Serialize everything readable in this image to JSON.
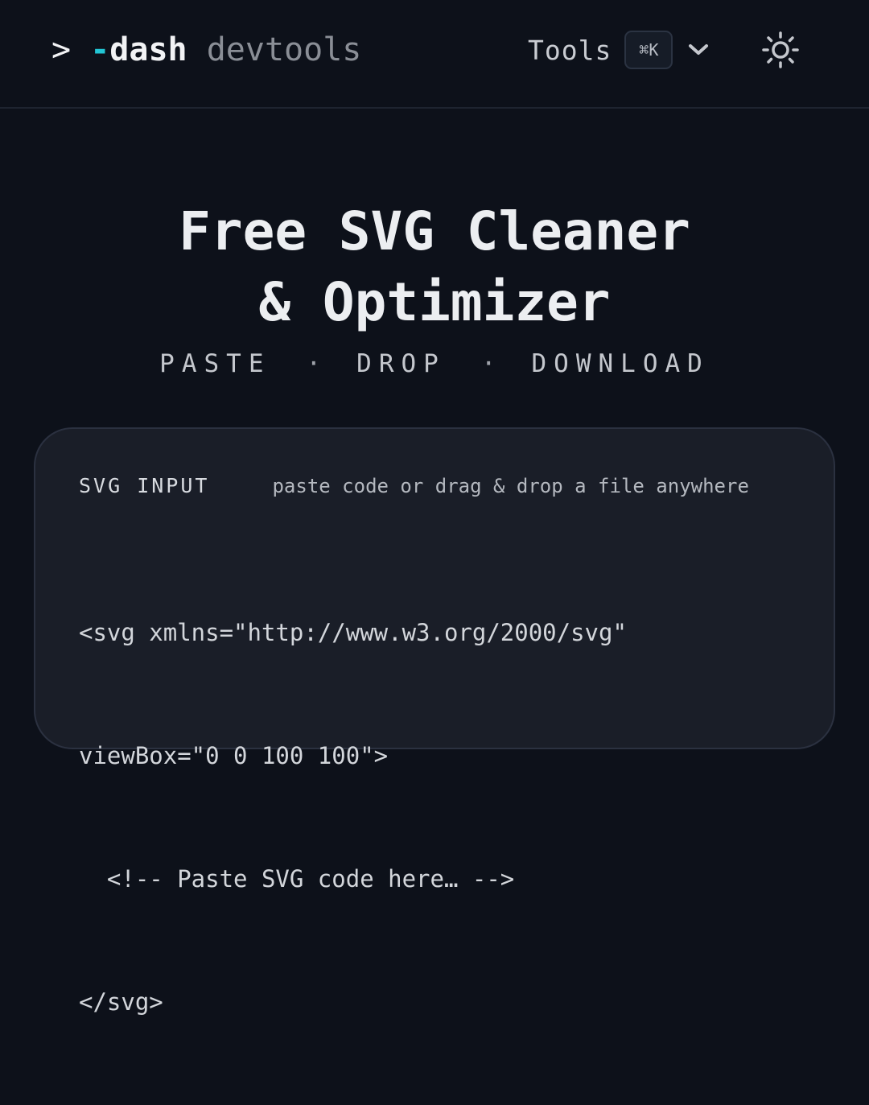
{
  "header": {
    "logo_prompt": ">",
    "logo_dash_prefix": "-",
    "logo_dash_word": "dash",
    "logo_product": "devtools",
    "tools_label": "Tools",
    "tools_shortcut": "⌘K",
    "tools_icon": "chevron-down-icon",
    "theme_icon": "sun-icon"
  },
  "hero": {
    "title": "Free SVG Cleaner & Optimizer",
    "steps": [
      "PASTE",
      "DROP",
      "DOWNLOAD"
    ],
    "separator": "·"
  },
  "input_card": {
    "title": "SVG INPUT",
    "hint": "paste code or drag & drop a file anywhere",
    "code_lines": [
      "<svg xmlns=\"http://www.w3.org/2000/svg\"",
      "viewBox=\"0 0 100 100\">",
      "  <!-- Paste SVG code here… -->",
      "</svg>"
    ]
  },
  "colors": {
    "background": "#0d111a",
    "accent": "#22c5d4",
    "card": "#1a1e28"
  }
}
